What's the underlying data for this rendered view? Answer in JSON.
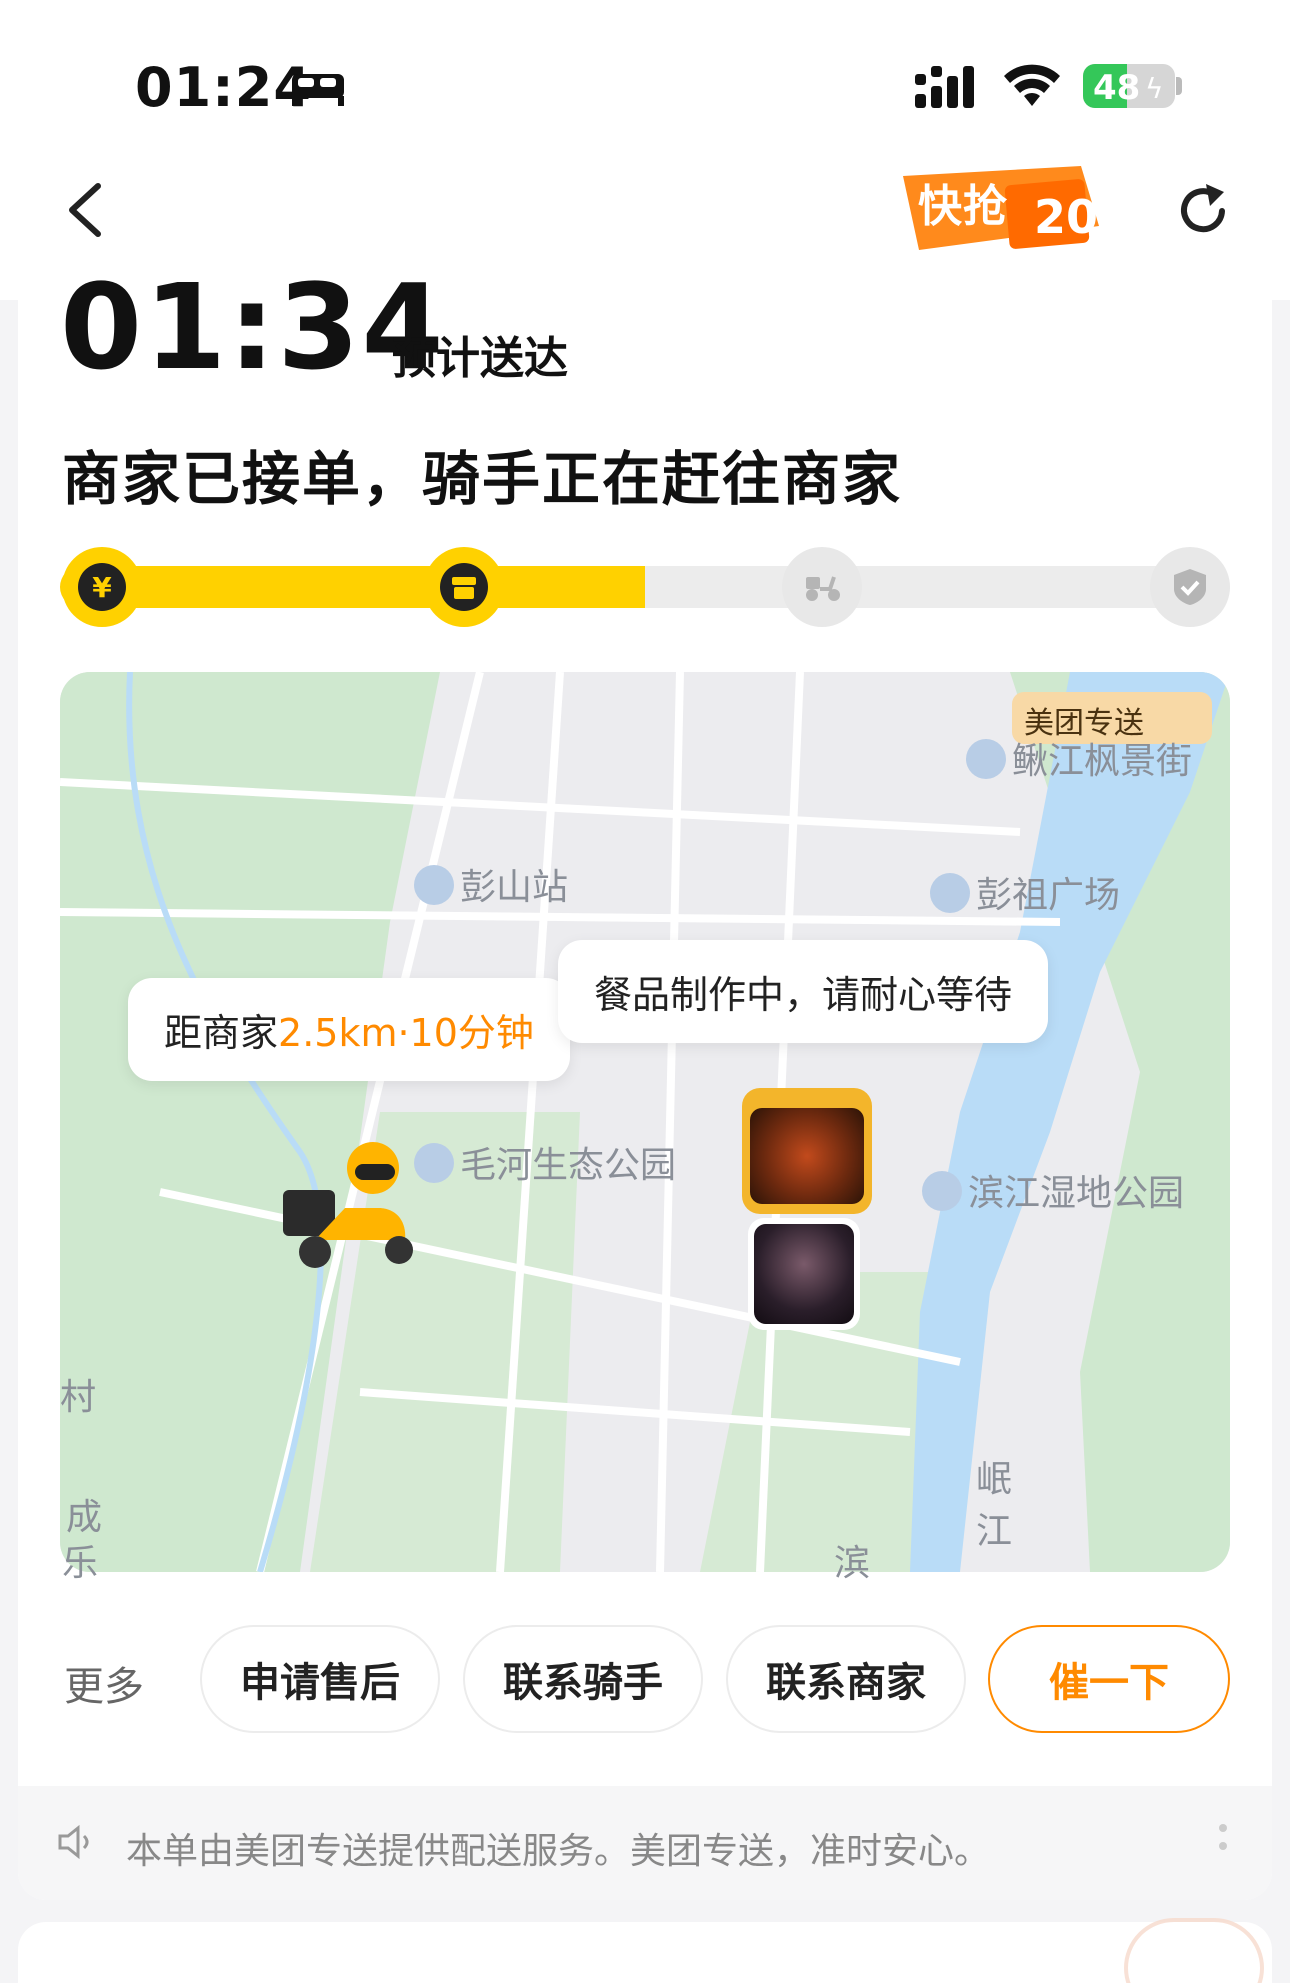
{
  "status_bar": {
    "time": "01:24",
    "battery": "48",
    "battery_level_percent": 48
  },
  "header": {
    "promo_text": "快抢",
    "promo_number": "20"
  },
  "eta": {
    "time": "01:34",
    "label": "预计送达"
  },
  "order_status": "商家已接单，骑手正在赶往商家",
  "progress": {
    "steps": [
      {
        "icon": "yuan-icon",
        "state": "done"
      },
      {
        "icon": "store-icon",
        "state": "done"
      },
      {
        "icon": "scooter-icon",
        "state": "pending"
      },
      {
        "icon": "check-shield-icon",
        "state": "pending"
      }
    ],
    "fill_fraction": 0.5,
    "active_color": "#ffd100",
    "inactive_color": "#ececec"
  },
  "map": {
    "brand_badge": "美团专送",
    "labels": {
      "poi_1": "鳅江枫景街",
      "poi_2": "彭山站",
      "poi_3": "彭祖广场",
      "poi_4": "毛河生态公园",
      "poi_5": "滨江湿地公园",
      "river_1": "岷",
      "river_2": "江",
      "edge_1": "村",
      "edge_2": "成",
      "edge_3": "乐",
      "edge_4": "滨"
    },
    "rider_bubble": {
      "prefix": "距商家",
      "distance": "2.5km·10分钟"
    },
    "merchant_bubble": "餐品制作中，请耐心等待",
    "accent_color": "#ff8a00",
    "water_color": "#b9dcf7",
    "green_color": "#cfe8cf"
  },
  "actions": {
    "more": "更多",
    "after_sale": "申请售后",
    "contact_rider": "联系骑手",
    "contact_merchant": "联系商家",
    "urge": "催一下"
  },
  "notice": {
    "text": "本单由美团专送提供配送服务。美团专送，准时安心。"
  }
}
